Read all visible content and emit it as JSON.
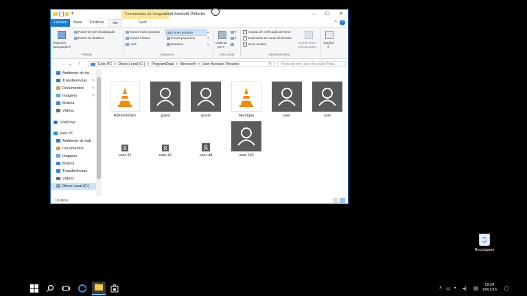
{
  "window": {
    "title": "User Account Pictures",
    "context_tab": "Ferramentas de Imagem",
    "controls": {
      "minimize": "—",
      "maximize": "☐",
      "close": "✕"
    }
  },
  "ribbon_tabs": [
    {
      "label": "Ficheiro"
    },
    {
      "label": "Base"
    },
    {
      "label": "Partilhar"
    },
    {
      "label": "Ver"
    },
    {
      "label": "Gerir"
    }
  ],
  "ribbon": {
    "panes": {
      "nav_pane_line1": "Painel de",
      "nav_pane_line2": "navegação ▾",
      "preview": "Painel de pré-visualização",
      "details": "Painel de detalhes",
      "group": "Painéis"
    },
    "layout": {
      "extra_large": "Ícones muito grandes",
      "large": "Ícones grandes",
      "medium": "Ícones médios",
      "small": "Ícones pequenos",
      "list": "Lista",
      "details": "Detalhes",
      "group": "Esquema"
    },
    "current_view": {
      "sort_line1": "Ordenar",
      "sort_line2": "por ▾",
      "group": "Vista atual"
    },
    "show_hide": {
      "checkboxes": "Caixas de verificação de itens",
      "extensions": "Extensões de nome de ficheiro",
      "hidden": "Itens ocultos",
      "hide_selected_line1": "Ocultar itens",
      "hide_selected_line2": "selecionados",
      "group": "Mostrar/ocultar"
    },
    "options": {
      "label": "Opções"
    }
  },
  "address": {
    "segments": [
      "Este PC",
      ">",
      "Disco Local (C:)",
      ">",
      "ProgramData",
      ">",
      "Microsoft",
      ">",
      "User Account Pictures"
    ],
    "search_placeholder": "Procurar em User Account Pictu..."
  },
  "nav_pane": [
    {
      "label": "Ambiente de tra",
      "pinned": true
    },
    {
      "label": "Transferências",
      "pinned": true
    },
    {
      "label": "Documentos",
      "pinned": true
    },
    {
      "label": "Imagens",
      "pinned": true
    },
    {
      "label": "Música"
    },
    {
      "label": "Vídeos"
    },
    {
      "label": "OneDrive"
    },
    {
      "label": "Este PC"
    },
    {
      "label": "Ambiente de trab"
    },
    {
      "label": "Documentos"
    },
    {
      "label": "Imagens"
    },
    {
      "label": "Música"
    },
    {
      "label": "Transferências"
    },
    {
      "label": "Vídeos"
    },
    {
      "label": "Disco Local (C:)"
    }
  ],
  "files": [
    {
      "name": "Administrator",
      "kind": "vlc"
    },
    {
      "name": "guest",
      "kind": "user"
    },
    {
      "name": "guest",
      "kind": "user"
    },
    {
      "name": "Henrique",
      "kind": "vlc"
    },
    {
      "name": "user",
      "kind": "user"
    },
    {
      "name": "user",
      "kind": "user"
    },
    {
      "name": "user-32",
      "kind": "small"
    },
    {
      "name": "user-40",
      "kind": "small"
    },
    {
      "name": "user-48",
      "kind": "small"
    },
    {
      "name": "user-192",
      "kind": "user"
    }
  ],
  "status": {
    "count": "10 itens"
  },
  "desktop": {
    "recycle_bin": "Reciclagem"
  },
  "taskbar": {
    "time": "19:24",
    "date": "19/01/16"
  },
  "colors": {
    "accent": "#1979ca",
    "selection": "#cce4f7",
    "context_tab": "#f6e7a6"
  }
}
